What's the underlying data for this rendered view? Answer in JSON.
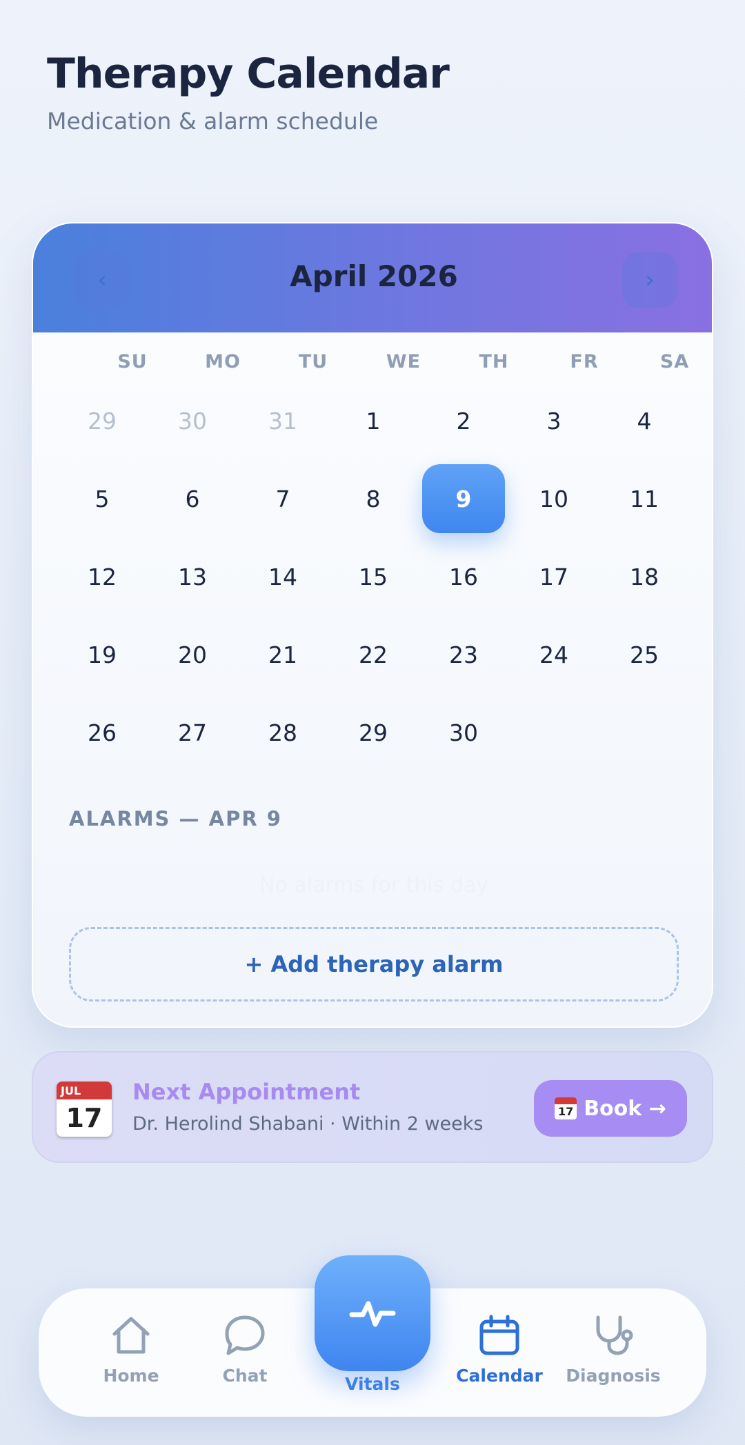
{
  "header": {
    "title": "Therapy Calendar",
    "subtitle": "Medication & alarm schedule"
  },
  "calendar": {
    "month_label": "April 2026",
    "prev_icon": "chevron-left-icon",
    "next_icon": "chevron-right-icon",
    "prev_glyph": "‹",
    "next_glyph": "›",
    "weekdays": [
      "SU",
      "MO",
      "TU",
      "WE",
      "TH",
      "FR",
      "SA"
    ],
    "weeks": [
      [
        "29",
        "30",
        "31",
        "1",
        "2",
        "3",
        "4"
      ],
      [
        "5",
        "6",
        "7",
        "8",
        "9",
        "10",
        "11"
      ],
      [
        "12",
        "13",
        "14",
        "15",
        "16",
        "17",
        "18"
      ],
      [
        "19",
        "20",
        "21",
        "22",
        "23",
        "24",
        "25"
      ],
      [
        "26",
        "27",
        "28",
        "29",
        "30"
      ]
    ],
    "outside_month_days": [
      "29",
      "30",
      "31"
    ],
    "selected_day": "9"
  },
  "alarms": {
    "section_label": "ALARMS — APR 9",
    "empty_text": "No alarms for this day",
    "add_button_label": "+ Add therapy alarm"
  },
  "appointment": {
    "icon": "calendar-date-icon",
    "icon_month": "JUL",
    "icon_day": "17",
    "title": "Next Appointment",
    "subtitle": "Dr. Herolind Shabani · Within 2 weeks",
    "book_label": "Book →"
  },
  "bottom_nav": {
    "items": [
      {
        "label": "Home",
        "icon": "home-icon"
      },
      {
        "label": "Chat",
        "icon": "chat-bubble-icon"
      },
      {
        "label": "Vitals",
        "icon": "pulse-icon"
      },
      {
        "label": "Calendar",
        "icon": "calendar-icon"
      },
      {
        "label": "Diagnosis",
        "icon": "stethoscope-icon"
      }
    ],
    "active": "Calendar"
  },
  "colors": {
    "accent": "#3f87f0",
    "header_gradient_start": "#4a80dc",
    "header_gradient_end": "#8a70e2",
    "appointment_accent": "#a78cf4"
  }
}
